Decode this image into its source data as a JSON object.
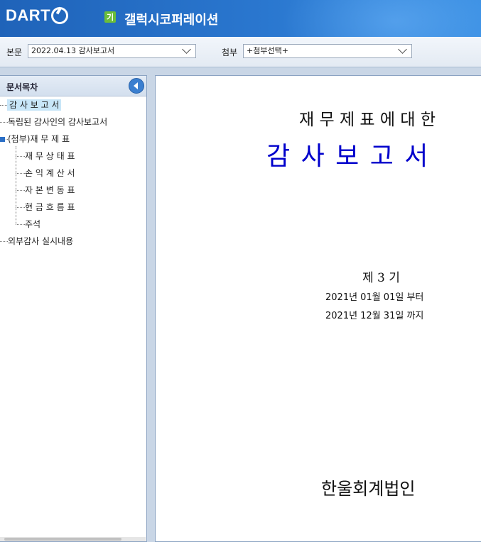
{
  "header": {
    "logo": "DART",
    "company_badge": "기",
    "company_name": "갤럭시코퍼레이션"
  },
  "toolbar": {
    "main_label": "본문",
    "main_select": "2022.04.13  감사보고서",
    "attach_label": "첨부",
    "attach_select": "+첨부선택+"
  },
  "sidebar": {
    "title": "문서목차",
    "items": [
      "감 사 보 고 서",
      "독립된 감사인의 감사보고서",
      "(첨부)재 무 제 표",
      "재 무 상 태 표",
      "손 익 계 산 서",
      "자 본 변 동 표",
      "현 금 흐 름 표",
      "주석",
      "외부감사 실시내용"
    ]
  },
  "document": {
    "subtitle": "재 무 제 표 에  대 한",
    "title": "감   사   보   고   서",
    "period_no": "제 3 기",
    "from": "2021년 01월 01일  부터",
    "to": "2021년 12월 31일  까지",
    "auditor": "한울회계법인"
  },
  "colors": {
    "header_blue": "#2a77cf",
    "title_blue": "#0000cc",
    "selection": "#c8e6f8"
  }
}
